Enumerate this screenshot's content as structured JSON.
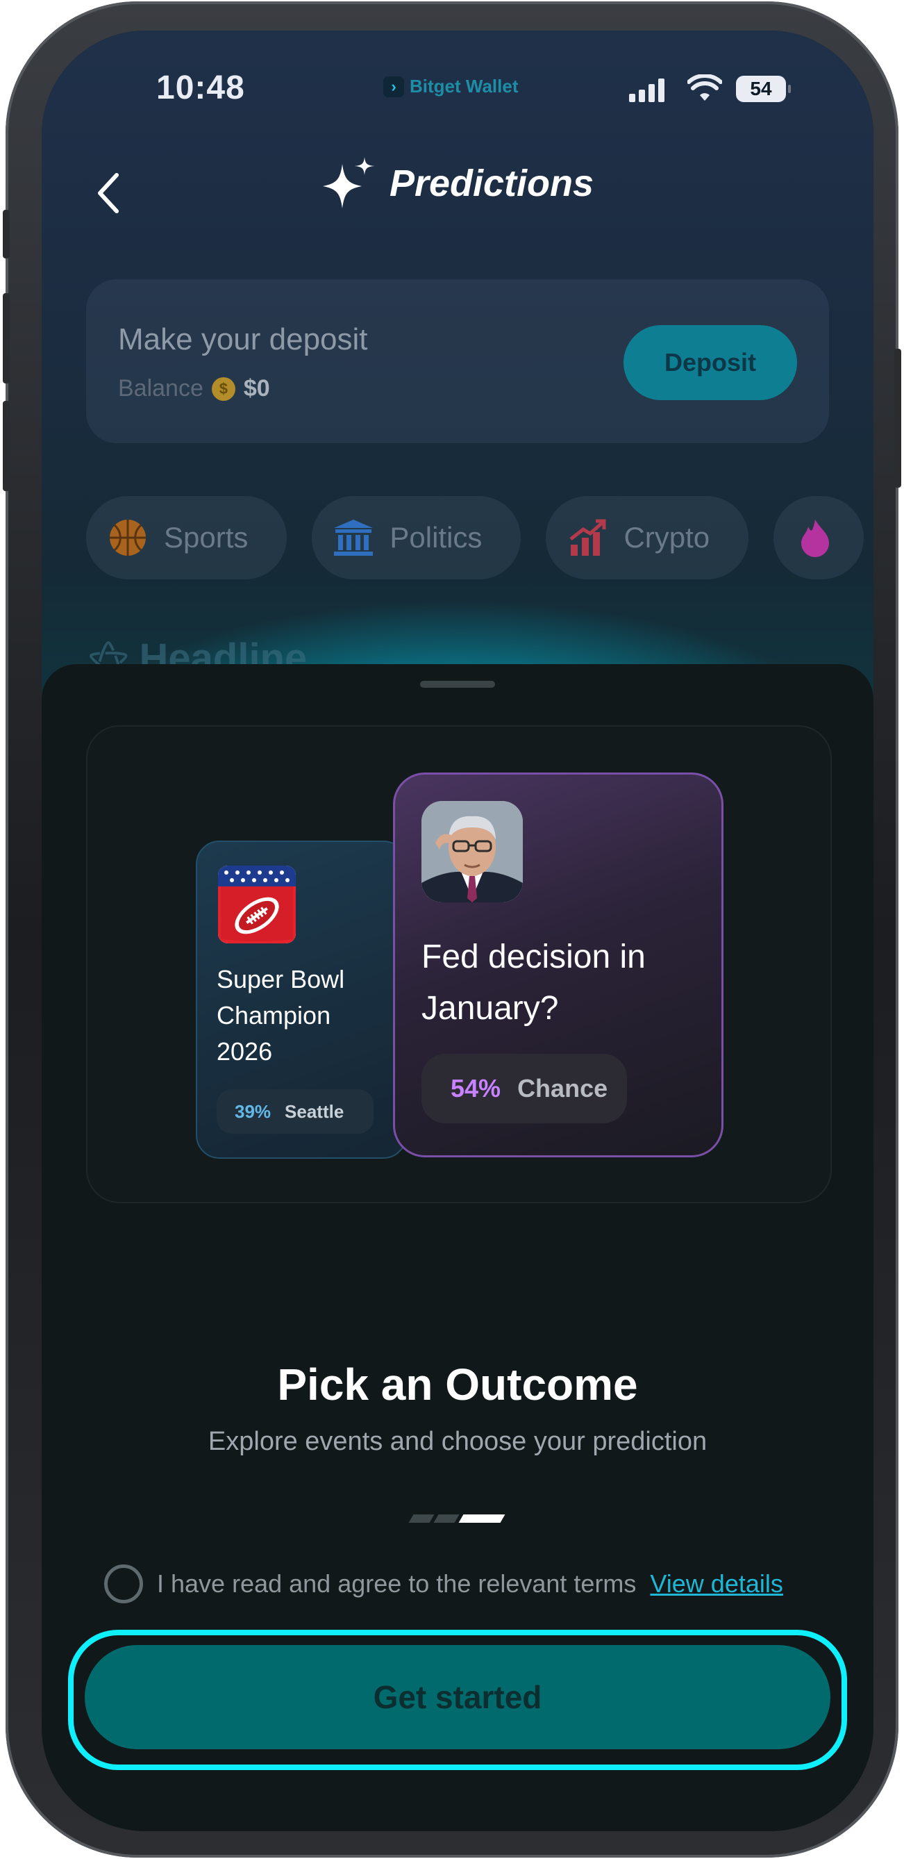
{
  "status_bar": {
    "time": "10:48",
    "carrier": "Bitget Wallet",
    "battery": "54"
  },
  "header": {
    "title": "Predictions"
  },
  "deposit_card": {
    "title": "Make your deposit",
    "balance_label": "Balance",
    "balance_value": "$0",
    "deposit_button": "Deposit"
  },
  "categories": [
    {
      "label": "Sports",
      "icon": "basketball-icon"
    },
    {
      "label": "Politics",
      "icon": "government-building-icon"
    },
    {
      "label": "Crypto",
      "icon": "chart-up-icon"
    }
  ],
  "background_section": {
    "headline": "Headline"
  },
  "onboarding": {
    "card_left": {
      "title": "Super Bowl Champion 2026",
      "percent": "39%",
      "outcome": "Seattle",
      "icon": "football-icon"
    },
    "card_right": {
      "title": "Fed decision in January?",
      "percent": "54%",
      "outcome": "Chance",
      "icon": "person-photo"
    },
    "heading": "Pick an Outcome",
    "subheading": "Explore events and choose your prediction",
    "step_current": 3,
    "step_total": 3
  },
  "terms": {
    "text": "I have read and agree to the relevant terms",
    "link": "View details",
    "checked": false
  },
  "cta": {
    "label": "Get started"
  },
  "colors": {
    "accent": "#0ff0ff",
    "cta_bg": "#016a6c",
    "purple": "#c783ff",
    "blue": "#63b8e6"
  }
}
